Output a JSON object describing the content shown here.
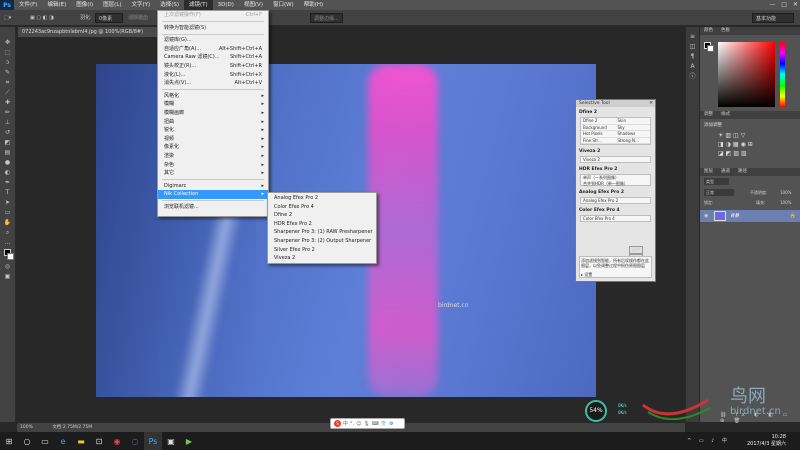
{
  "menubar": {
    "logo": "Ps",
    "items": [
      "文件(F)",
      "编辑(E)",
      "图像(I)",
      "图层(L)",
      "文字(Y)",
      "选择(S)",
      "滤镜(T)",
      "3D(D)",
      "视图(V)",
      "窗口(W)",
      "帮助(H)"
    ],
    "active_index": 6
  },
  "options": {
    "feather_label": "羽化:",
    "feather_value": "0像素",
    "antialias": "消除锯齿",
    "refine": "调整边缘...",
    "workspace": "基本功能"
  },
  "document_tab": "072243ac9nzapbtnlebml4.jpg @ 100%(RGB/8#)",
  "filter_menu": {
    "items": [
      {
        "label": "上次滤镜操作(F)",
        "shortcut": "Ctrl+F",
        "disabled": true
      },
      {
        "sep": true
      },
      {
        "label": "转换为智能滤镜(S)"
      },
      {
        "sep": true
      },
      {
        "label": "滤镜库(G)..."
      },
      {
        "label": "自适应广角(A)...",
        "shortcut": "Alt+Shift+Ctrl+A"
      },
      {
        "label": "Camera Raw 滤镜(C)...",
        "shortcut": "Shift+Ctrl+A"
      },
      {
        "label": "镜头校正(R)...",
        "shortcut": "Shift+Ctrl+R"
      },
      {
        "label": "液化(L)...",
        "shortcut": "Shift+Ctrl+X"
      },
      {
        "label": "消失点(V)...",
        "shortcut": "Alt+Ctrl+V"
      },
      {
        "sep": true
      },
      {
        "label": "风格化",
        "sub": true
      },
      {
        "label": "模糊",
        "sub": true
      },
      {
        "label": "模糊画廊",
        "sub": true
      },
      {
        "label": "扭曲",
        "sub": true
      },
      {
        "label": "锐化",
        "sub": true
      },
      {
        "label": "视频",
        "sub": true
      },
      {
        "label": "像素化",
        "sub": true
      },
      {
        "label": "渲染",
        "sub": true
      },
      {
        "label": "杂色",
        "sub": true
      },
      {
        "label": "其它",
        "sub": true
      },
      {
        "sep": true
      },
      {
        "label": "Digimarc",
        "sub": true
      },
      {
        "label": "Nik Collection",
        "sub": true,
        "highlight": true
      },
      {
        "sep": true
      },
      {
        "label": "浏览联机滤镜..."
      }
    ]
  },
  "nik_submenu": {
    "items": [
      "Analog Efex Pro 2",
      "Color Efex Pro 4",
      "Dfine 2",
      "HDR Efex Pro 2",
      "Sharpener Pro 3: (1) RAW Presharpener",
      "Sharpener Pro 3: (2) Output Sharpener",
      "Silver Efex Pro 2",
      "Viveza 2"
    ]
  },
  "selective_tool": {
    "title": "Selective Tool",
    "sections": [
      {
        "title": "Dfine 2",
        "grid": [
          "Dfine 2",
          "Skin",
          "Background",
          "Sky",
          "Hot Pixels",
          "Shadows",
          "Fine Str...",
          "Strong N..."
        ]
      },
      {
        "title": "Viveza 2",
        "box": "Viveza 2"
      },
      {
        "title": "HDR Efex Pro 2",
        "box2": [
          "单声（一系列图像）",
          "合并到HDR（单一图像）"
        ]
      },
      {
        "title": "Analog Efex Pro 2",
        "box": "Analog Efex Pro 2"
      },
      {
        "title": "Color Efex Pro 4",
        "box": "Color Efex Pro 4"
      }
    ],
    "footer_text": "添加滤镜到智能，所有后续操作都在此图层，以免调整过程中损伤原图图层",
    "btn_apply": "清除",
    "btn_close": "刷新",
    "settings": "设置"
  },
  "panels": {
    "color_tabs": [
      "颜色",
      "色板"
    ],
    "adjust_tabs": [
      "调整",
      "样式"
    ],
    "adjust_title": "添加调整",
    "layer_tabs": [
      "图层",
      "通道",
      "路径"
    ],
    "layer_kind": "类型",
    "blend_mode": "正常",
    "opacity_label": "不透明度:",
    "opacity_value": "100%",
    "lock_label": "锁定:",
    "fill_label": "填充:",
    "fill_value": "100%",
    "layer_name": "背景"
  },
  "statusbar": {
    "zoom": "100%",
    "doc": "文档:2.75M/2.75M"
  },
  "photo_watermark": "birdnet.cn",
  "site_mark": {
    "cn": "鸟网",
    "en": "birdnet.cn"
  },
  "gauge": {
    "value": "54%",
    "up": "0K/s",
    "down": "0K/s"
  },
  "ime": {
    "label": "中"
  },
  "clock": {
    "time": "10:28",
    "date": "2017/4/3 星期六"
  }
}
